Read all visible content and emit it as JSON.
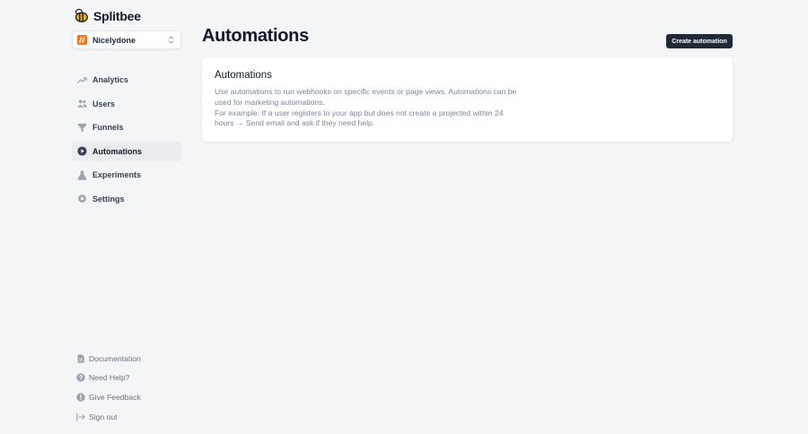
{
  "app": {
    "name": "Splitbee"
  },
  "project": {
    "name": "Nicelydone"
  },
  "sidebar": {
    "items": [
      {
        "label": "Analytics",
        "icon": "chart-line-icon",
        "active": false
      },
      {
        "label": "Users",
        "icon": "users-icon",
        "active": false
      },
      {
        "label": "Funnels",
        "icon": "funnel-icon",
        "active": false
      },
      {
        "label": "Automations",
        "icon": "play-circle-icon",
        "active": true
      },
      {
        "label": "Experiments",
        "icon": "flask-icon",
        "active": false
      },
      {
        "label": "Settings",
        "icon": "gear-icon",
        "active": false
      }
    ],
    "bottom": [
      {
        "label": "Documentation",
        "icon": "document-icon"
      },
      {
        "label": "Need Help?",
        "icon": "question-circle-icon"
      },
      {
        "label": "Give Feedback",
        "icon": "exclamation-circle-icon"
      },
      {
        "label": "Sign out",
        "icon": "sign-out-icon"
      }
    ]
  },
  "main": {
    "title": "Automations",
    "create_button": "Create automation",
    "card": {
      "title": "Automations",
      "description_line1": "Use automations to run webhooks on specific events or page views. Automations can be used for marketing automations.",
      "description_line2": "For example: If a user registers to your app but does not create a projected within 24 hours → Send email and ask if they need help."
    }
  },
  "colors": {
    "background": "#f4f5f7",
    "button": "#1f2937",
    "logo": "#f5b400",
    "project_avatar": "#f97316"
  }
}
